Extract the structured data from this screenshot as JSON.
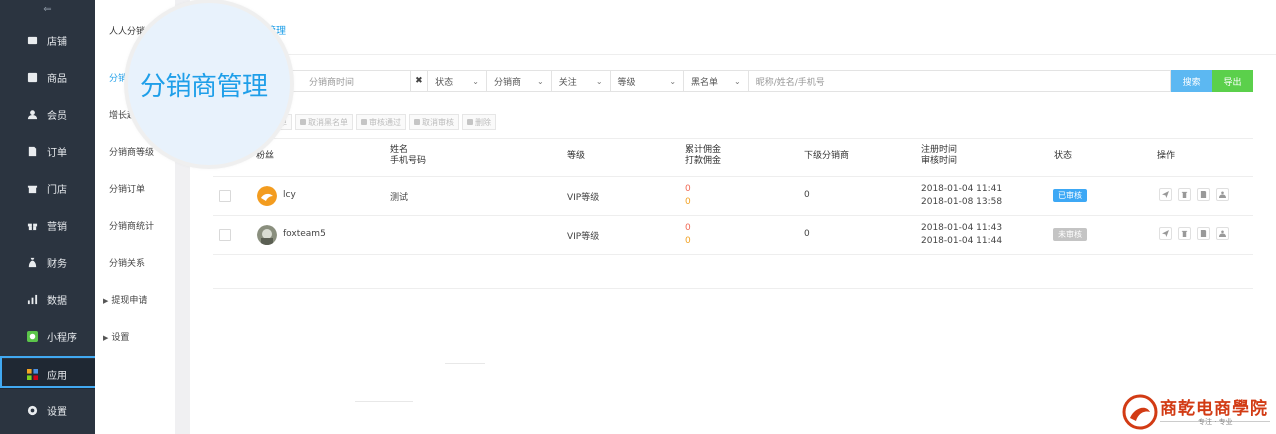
{
  "sidebar": {
    "items": [
      {
        "label": "店铺",
        "icon": "store-icon"
      },
      {
        "label": "商品",
        "icon": "goods-icon"
      },
      {
        "label": "会员",
        "icon": "member-icon"
      },
      {
        "label": "订单",
        "icon": "order-icon"
      },
      {
        "label": "门店",
        "icon": "shop-icon"
      },
      {
        "label": "营销",
        "icon": "gift-icon"
      },
      {
        "label": "财务",
        "icon": "money-bag-icon"
      },
      {
        "label": "数据",
        "icon": "bar-chart-icon"
      },
      {
        "label": "小程序",
        "icon": "mini-program-icon"
      },
      {
        "label": "应用",
        "icon": "apps-grid-icon",
        "active": true
      },
      {
        "label": "设置",
        "icon": "gear-icon"
      }
    ]
  },
  "subnav": {
    "header": "人人分销",
    "items": [
      "分销商",
      "增长趋",
      "分销商等级",
      "分销订单",
      "分销商统计",
      "分销关系"
    ],
    "groups": [
      "提现申请",
      "设置"
    ]
  },
  "breadcrumb": "管理",
  "magnifier_text": "分销商管理",
  "filters": {
    "time_label": "分销商时间",
    "clear_icon": "✖",
    "status": "状态",
    "distributor": "分销商",
    "follow": "关注",
    "level": "等级",
    "blacklist": "黑名单",
    "search_placeholder": "昵称/姓名/手机号",
    "search_button": "搜索",
    "export_button": "导出"
  },
  "bulk_actions": [
    "单",
    "取消黑名单",
    "审核通过",
    "取消审核",
    "删除"
  ],
  "table": {
    "headers": {
      "fans": "粉丝",
      "name": "姓名",
      "phone": "手机号码",
      "level": "等级",
      "total_commission": "累计佣金",
      "paid_commission": "打款佣金",
      "sub_distributors": "下级分销商",
      "register_time": "注册时间",
      "review_time": "审核时间",
      "status": "状态",
      "actions": "操作"
    },
    "rows": [
      {
        "fan": "lcy",
        "name": "测试",
        "level": "VIP等级",
        "total_commission": "0",
        "paid_commission": "0",
        "sub_count": "0",
        "register_time": "2018-01-04 11:41",
        "review_time": "2018-01-08 13:58",
        "status": "已审核",
        "status_color": "#3da8f5"
      },
      {
        "fan": "foxteam5",
        "name": "",
        "level": "VIP等级",
        "total_commission": "0",
        "paid_commission": "0",
        "sub_count": "0",
        "register_time": "2018-01-04 11:43",
        "review_time": "2018-01-04 11:44",
        "status": "未审核",
        "status_color": "#c4c4c4"
      }
    ]
  },
  "brand": {
    "title": "商乾电商學院",
    "subtitle": "专注 · 专业"
  },
  "colors": {
    "sidebar_bg": "#2b3440",
    "accent_blue": "#1f9fe9",
    "search_btn": "#5cb8f2",
    "export_btn": "#5bd04b",
    "highlight_border": "#41a9f2",
    "brand_red": "#d23b14"
  }
}
